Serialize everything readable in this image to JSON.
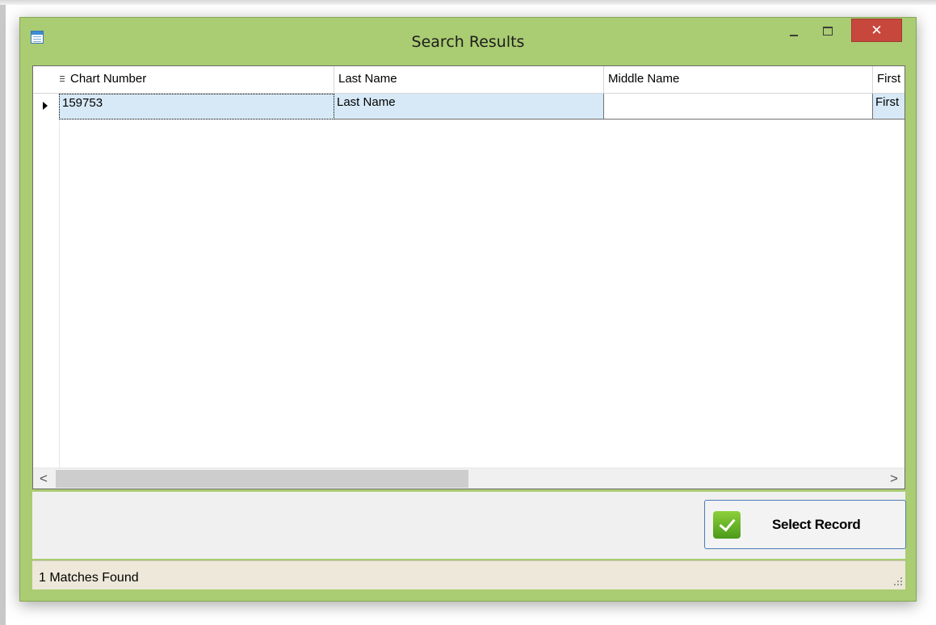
{
  "window": {
    "title": "Search Results",
    "close_label": "✕"
  },
  "grid": {
    "columns": [
      "Chart Number",
      "Last Name",
      "Middle Name",
      "First"
    ],
    "rows": [
      [
        "159753",
        "Last Name",
        "",
        "First"
      ]
    ]
  },
  "scrollbar": {
    "left_arrow": "<",
    "right_arrow": ">"
  },
  "actions": {
    "select_record_label": "Select Record"
  },
  "status": {
    "text": "1 Matches Found"
  },
  "colors": {
    "window_frame": "#aacc72",
    "close_button": "#c7473c",
    "selected_row": "#d7e9f7",
    "check_icon": "#6bb52a"
  },
  "icons": [
    "app-window-icon",
    "minimize-icon",
    "maximize-icon",
    "close-icon",
    "row-pointer-icon",
    "checkmark-icon",
    "resize-grip-icon"
  ]
}
